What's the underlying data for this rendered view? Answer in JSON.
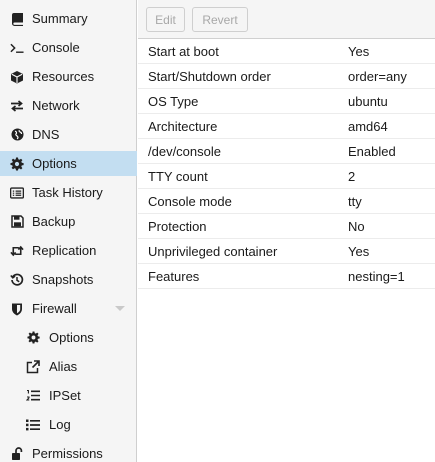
{
  "sidebar": {
    "items": [
      {
        "label": "Summary",
        "icon": "book-icon"
      },
      {
        "label": "Console",
        "icon": "terminal-icon"
      },
      {
        "label": "Resources",
        "icon": "cube-icon"
      },
      {
        "label": "Network",
        "icon": "exchange-icon"
      },
      {
        "label": "DNS",
        "icon": "globe-icon"
      },
      {
        "label": "Options",
        "icon": "gear-icon",
        "selected": true
      },
      {
        "label": "Task History",
        "icon": "list-alt-icon"
      },
      {
        "label": "Backup",
        "icon": "floppy-icon"
      },
      {
        "label": "Replication",
        "icon": "retweet-icon"
      },
      {
        "label": "Snapshots",
        "icon": "history-icon"
      },
      {
        "label": "Firewall",
        "icon": "shield-icon",
        "expandable": true
      },
      {
        "label": "Options",
        "icon": "gear-icon"
      },
      {
        "label": "Alias",
        "icon": "external-link-icon"
      },
      {
        "label": "IPSet",
        "icon": "list-ol-icon"
      },
      {
        "label": "Log",
        "icon": "list-icon"
      },
      {
        "label": "Permissions",
        "icon": "unlock-icon"
      }
    ]
  },
  "toolbar": {
    "edit_label": "Edit",
    "revert_label": "Revert"
  },
  "options": {
    "rows": [
      {
        "key": "Start at boot",
        "value": "Yes"
      },
      {
        "key": "Start/Shutdown order",
        "value": "order=any"
      },
      {
        "key": "OS Type",
        "value": "ubuntu"
      },
      {
        "key": "Architecture",
        "value": "amd64"
      },
      {
        "key": "/dev/console",
        "value": "Enabled"
      },
      {
        "key": "TTY count",
        "value": "2"
      },
      {
        "key": "Console mode",
        "value": "tty"
      },
      {
        "key": "Protection",
        "value": "No"
      },
      {
        "key": "Unprivileged container",
        "value": "Yes"
      },
      {
        "key": "Features",
        "value": "nesting=1"
      }
    ]
  },
  "colors": {
    "selected_bg": "#c3def1",
    "sidebar_bg": "#f5f5f5",
    "icon": "#222222",
    "disabled_text": "#a8a8a8"
  }
}
